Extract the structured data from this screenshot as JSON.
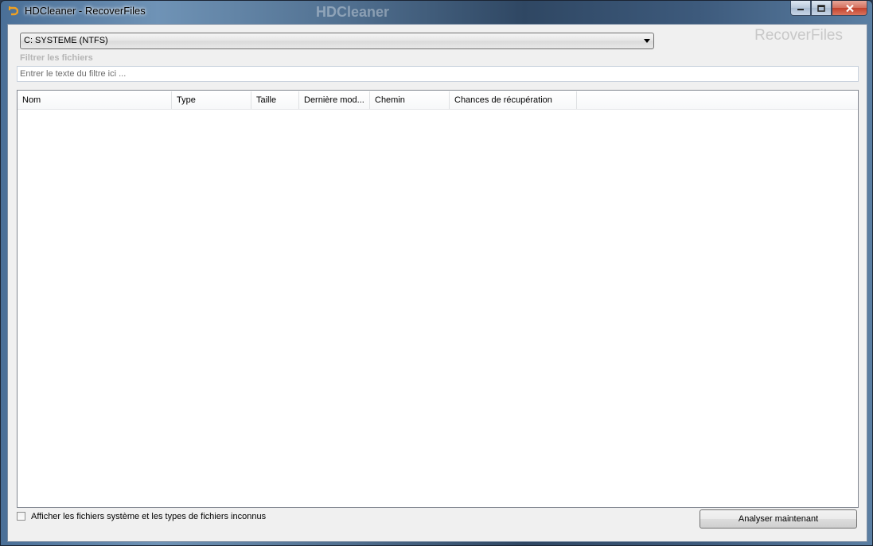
{
  "window": {
    "title": "HDCleaner - RecoverFiles",
    "background_text": [
      "HDCleaner"
    ]
  },
  "drive_select": {
    "value": "C: SYSTEME (NTFS)"
  },
  "brand": "RecoverFiles",
  "filter": {
    "label": "Filtrer les fichiers",
    "placeholder": "Entrer le texte du filtre ici ..."
  },
  "file_list": {
    "columns": [
      "Nom",
      "Type",
      "Taille",
      "Dernière mod...",
      "Chemin",
      "Chances de récupération"
    ],
    "rows": []
  },
  "options": {
    "show_system_label": "Afficher les fichiers système et les types de fichiers inconnus",
    "show_system_checked": false
  },
  "actions": {
    "analyze_label": "Analyser maintenant"
  },
  "colors": {
    "brand_text": "#c8c8c8",
    "filter_label": "#b5b5b5",
    "close_button": "#c3422d"
  }
}
